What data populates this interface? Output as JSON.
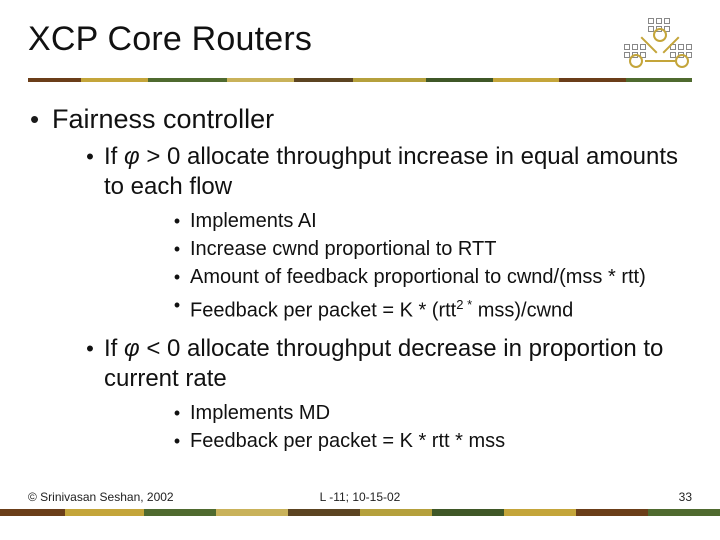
{
  "title": "XCP Core Routers",
  "bullets": {
    "l1": {
      "heading": "Fairness controller"
    },
    "l2a": {
      "text_pre": "If ",
      "phi": "φ",
      "text_post": " > 0 allocate throughput increase in equal amounts to each flow",
      "subs": [
        "Implements AI",
        "Increase cwnd proportional to RTT",
        "Amount of feedback proportional to cwnd/(mss * rtt)"
      ],
      "sub4_pre": "Feedback per packet = K * (rtt",
      "sub4_sup": "2 *",
      "sub4_post": " mss)/cwnd"
    },
    "l2b": {
      "text_pre": "If ",
      "phi": "φ",
      "text_post": " < 0 allocate throughput decrease in proportion to current rate",
      "subs": [
        "Implements MD",
        "Feedback per packet = K * rtt * mss"
      ]
    }
  },
  "footer": {
    "copyright": "© Srinivasan Seshan, 2002",
    "center": "L -11; 10-15-02",
    "page": "33"
  },
  "bullet_glyph": "•"
}
